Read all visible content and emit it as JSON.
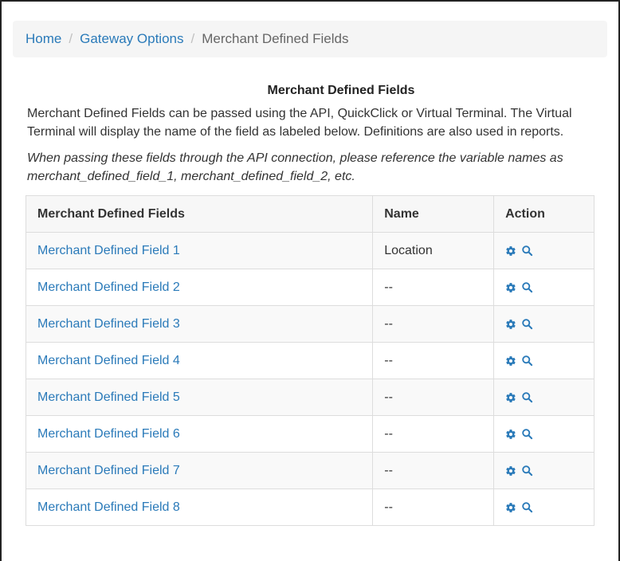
{
  "breadcrumb": {
    "items": [
      {
        "label": "Home"
      },
      {
        "label": "Gateway Options"
      },
      {
        "label": "Merchant Defined Fields"
      }
    ],
    "separator": "/"
  },
  "panel": {
    "title": "Merchant Defined Fields",
    "description": "Merchant Defined Fields can be passed using the API, QuickClick or Virtual Terminal. The Virtual Terminal will display the name of the field as labeled below. Definitions are also used in reports.",
    "note": "When passing these fields through the API connection, please reference the variable names as merchant_defined_field_1, merchant_defined_field_2, etc."
  },
  "table": {
    "headers": {
      "field": "Merchant Defined Fields",
      "name": "Name",
      "action": "Action"
    },
    "rows": [
      {
        "field": "Merchant Defined Field 1",
        "name": "Location"
      },
      {
        "field": "Merchant Defined Field 2",
        "name": "--"
      },
      {
        "field": "Merchant Defined Field 3",
        "name": "--"
      },
      {
        "field": "Merchant Defined Field 4",
        "name": "--"
      },
      {
        "field": "Merchant Defined Field 5",
        "name": "--"
      },
      {
        "field": "Merchant Defined Field 6",
        "name": "--"
      },
      {
        "field": "Merchant Defined Field 7",
        "name": "--"
      },
      {
        "field": "Merchant Defined Field 8",
        "name": "--"
      }
    ],
    "action_icons": [
      "gear-icon",
      "search-icon"
    ]
  },
  "colors": {
    "link": "#2a7ab9",
    "icon": "#2a7ab9",
    "row_stripe": "#f9f9f9"
  }
}
